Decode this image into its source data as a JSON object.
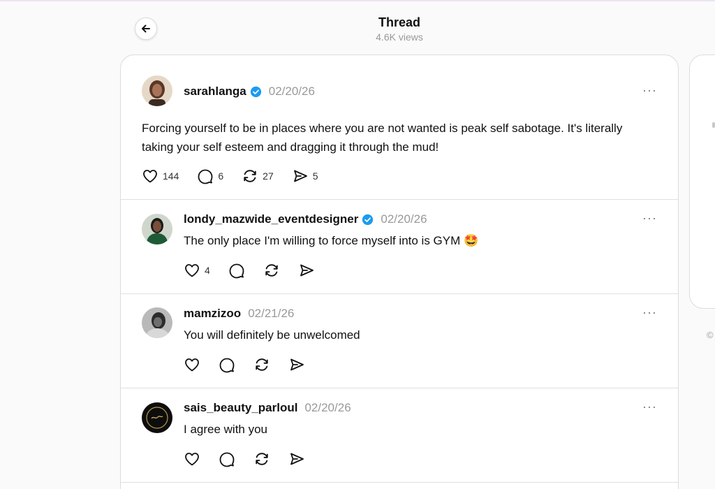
{
  "header": {
    "title": "Thread",
    "views": "4.6K views"
  },
  "side": {
    "copyright": "©"
  },
  "posts": [
    {
      "username": "sarahlanga",
      "verified": true,
      "date": "02/20/26",
      "text": "Forcing yourself to be in places where you are not wanted is peak self sabotage. It's literally taking your self esteem and dragging it through the mud!",
      "likes": "144",
      "comments": "6",
      "reposts": "27",
      "shares": "5",
      "more": "···"
    },
    {
      "username": "londy_mazwide_eventdesigner",
      "verified": true,
      "date": "02/20/26",
      "text": "The only place I'm willing to force myself into is GYM",
      "emoji": "🤩",
      "likes": "4",
      "more": "···"
    },
    {
      "username": "mamzizoo",
      "verified": false,
      "date": "02/21/26",
      "text": "You will definitely be unwelcomed",
      "more": "···"
    },
    {
      "username": "sais_beauty_parloul",
      "verified": false,
      "date": "02/20/26",
      "text": "I agree with you",
      "more": "···"
    }
  ],
  "icons": {
    "back": "arrow-left-icon",
    "like": "heart-icon",
    "comment": "comment-bubble-icon",
    "repost": "repost-icon",
    "share": "send-icon",
    "verified": "verified-badge-icon"
  },
  "colors": {
    "verified": "#1d9bf0",
    "date": "#999999",
    "border": "#dcdcdc"
  }
}
